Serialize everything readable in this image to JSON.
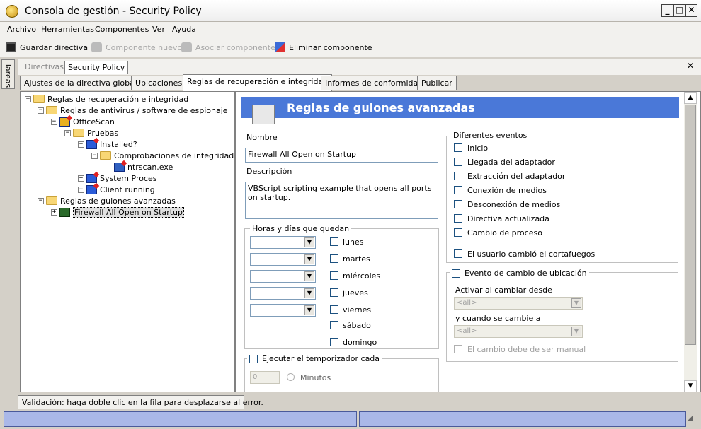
{
  "window": {
    "title": "Consola de gestión - Security Policy"
  },
  "menu": [
    "Archivo",
    "Herramientas",
    "Componentes",
    "Ver",
    "Ayuda"
  ],
  "toolbar": {
    "save": "Guardar directiva",
    "new_component": "Componente nuevo",
    "associate": "Asociar componente",
    "delete": "Eliminar componente"
  },
  "side_tab": "Tareas",
  "top_tabs": [
    "Directivas",
    "Security Policy"
  ],
  "policy_tabs": [
    "Ajustes de la directiva global",
    "Ubicaciones",
    "Reglas de recuperación e integridad",
    "Informes de conformidad",
    "Publicar"
  ],
  "tree": [
    {
      "label": "Reglas de recuperación e integridad"
    },
    {
      "label": "Reglas de antivirus / software de espionaje"
    },
    {
      "label": "OfficeScan"
    },
    {
      "label": "Pruebas"
    },
    {
      "label": "Installed?"
    },
    {
      "label": "Comprobaciones de integridad"
    },
    {
      "label": "ntrscan.exe"
    },
    {
      "label": "System Proces"
    },
    {
      "label": "Client running"
    },
    {
      "label": "Reglas de guiones avanzadas"
    },
    {
      "label": "Firewall All Open on Startup"
    }
  ],
  "panel": {
    "header": "Reglas de guiones avanzadas",
    "name_label": "Nombre",
    "name_value": "Firewall All Open on Startup",
    "desc_label": "Descripción",
    "desc_value": "VBScript scripting example that opens all ports on startup.",
    "hours_group": "Horas y días que quedan",
    "days": [
      "lunes",
      "martes",
      "miércoles",
      "jueves",
      "viernes",
      "sábado",
      "domingo"
    ],
    "timer_label": "Ejecutar el temporizador cada",
    "timer_value": "0",
    "minutes_label": "Minutos",
    "events_group": "Diferentes eventos",
    "events": [
      "Inicio",
      "Llegada del adaptador",
      "Extracción del adaptador",
      "Conexión de medios",
      "Desconexión de medios",
      "Directiva actualizada",
      "Cambio de proceso"
    ],
    "firewall_event": "El usuario cambió el cortafuegos",
    "location_event": "Evento de cambio de ubicación",
    "activate_from": "Activar al cambiar desde",
    "activate_from_value": "<all>",
    "and_when": "y cuando se cambie a",
    "and_when_value": "<all>",
    "manual_change": "El cambio debe de ser manual"
  },
  "status": "Validación: haga doble clic en la fila para desplazarse al error."
}
